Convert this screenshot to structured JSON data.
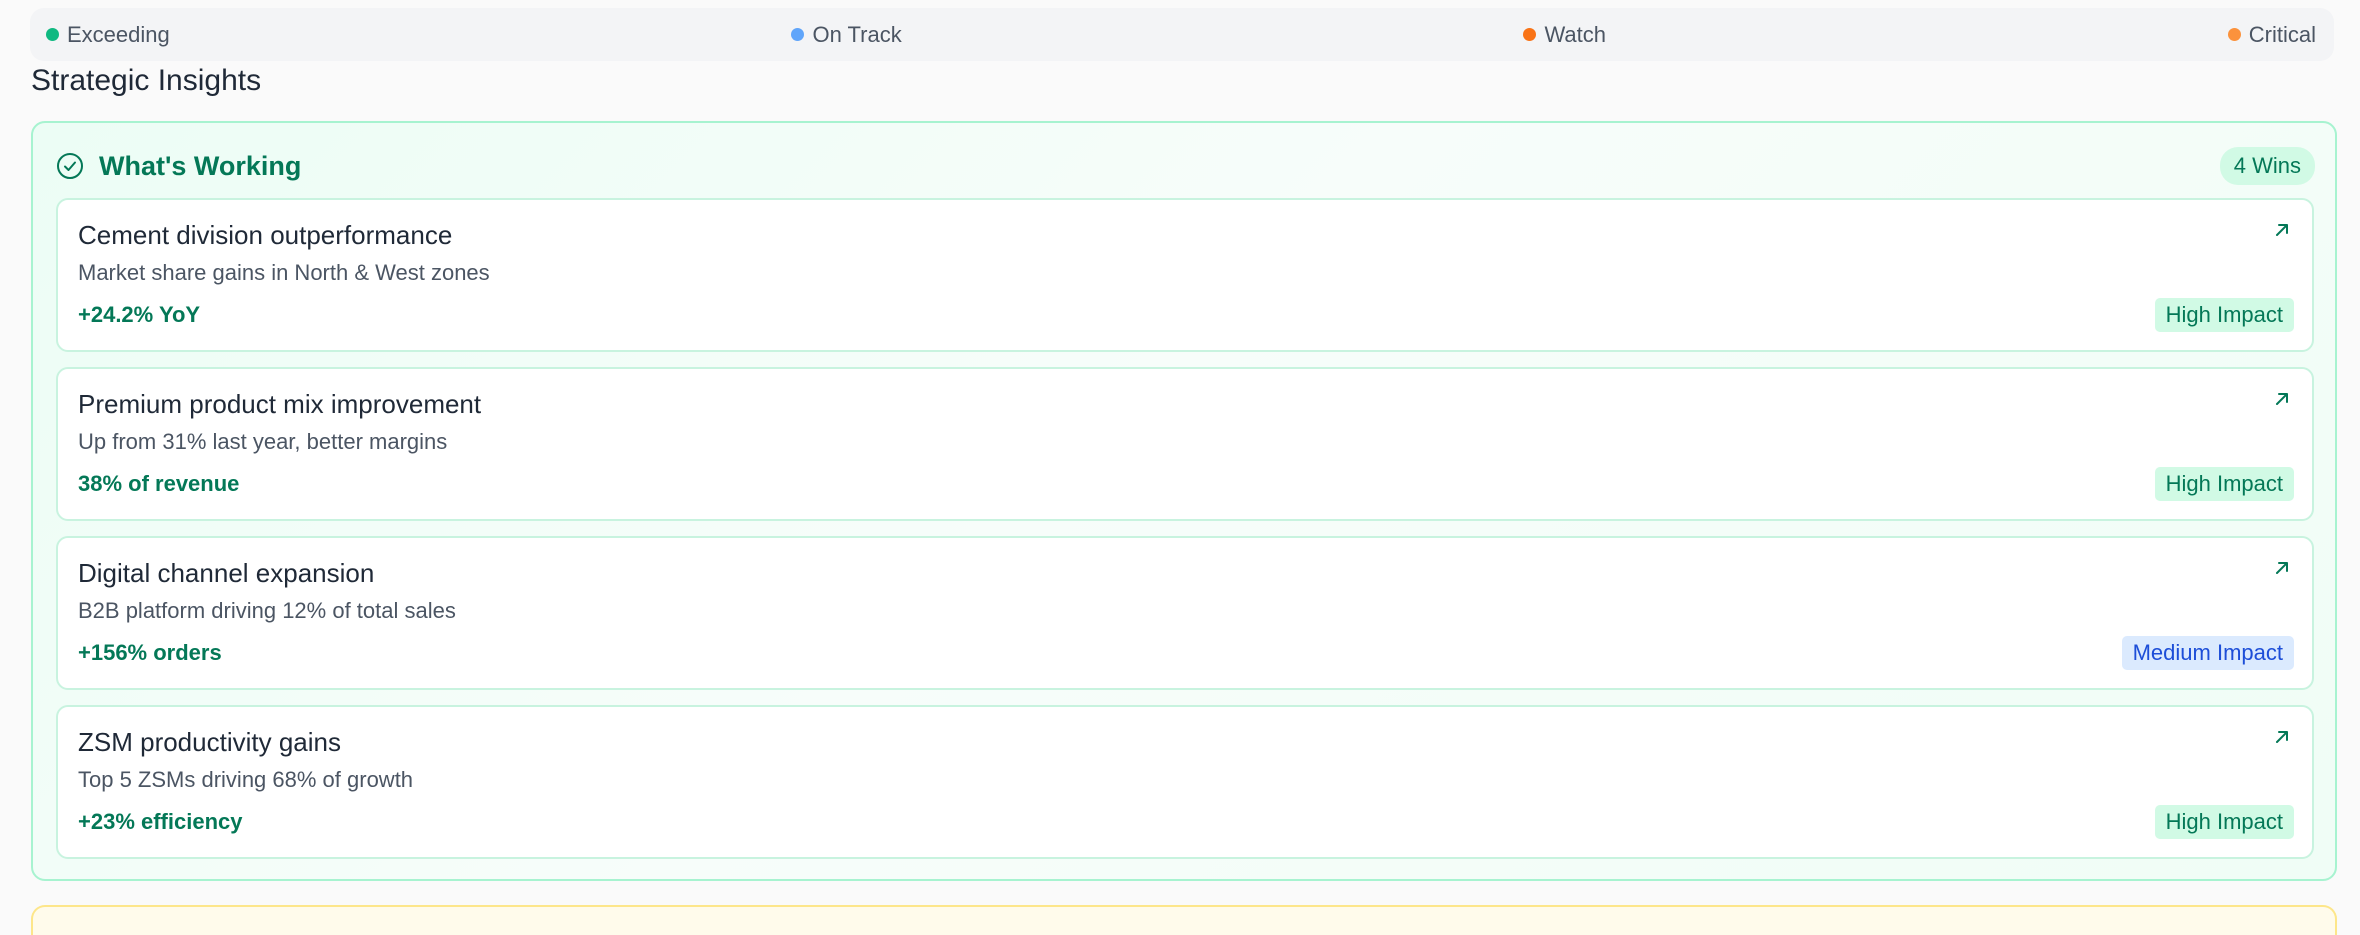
{
  "legend": [
    {
      "label": "Exceeding",
      "color": "#10b981"
    },
    {
      "label": "On Track",
      "color": "#60a5fa"
    },
    {
      "label": "Watch",
      "color": "#f97316"
    },
    {
      "label": "Critical",
      "color": "#fb923c"
    }
  ],
  "section": {
    "title": "Strategic Insights"
  },
  "working": {
    "title": "What's Working",
    "badge": "4 Wins",
    "icon": "check-circle-icon",
    "items": [
      {
        "title": "Cement division outperformance",
        "desc": "Market share gains in North & West zones",
        "metric": "+24.2% YoY",
        "impact": "High Impact",
        "impact_level": "high"
      },
      {
        "title": "Premium product mix improvement",
        "desc": "Up from 31% last year, better margins",
        "metric": "38% of revenue",
        "impact": "High Impact",
        "impact_level": "high"
      },
      {
        "title": "Digital channel expansion",
        "desc": "B2B platform driving 12% of total sales",
        "metric": "+156% orders",
        "impact": "Medium Impact",
        "impact_level": "medium"
      },
      {
        "title": "ZSM productivity gains",
        "desc": "Top 5 ZSMs driving 68% of growth",
        "metric": "+23% efficiency",
        "impact": "High Impact",
        "impact_level": "high"
      }
    ]
  },
  "colors": {
    "accent_green": "#047857",
    "accent_blue": "#1d4ed8"
  }
}
